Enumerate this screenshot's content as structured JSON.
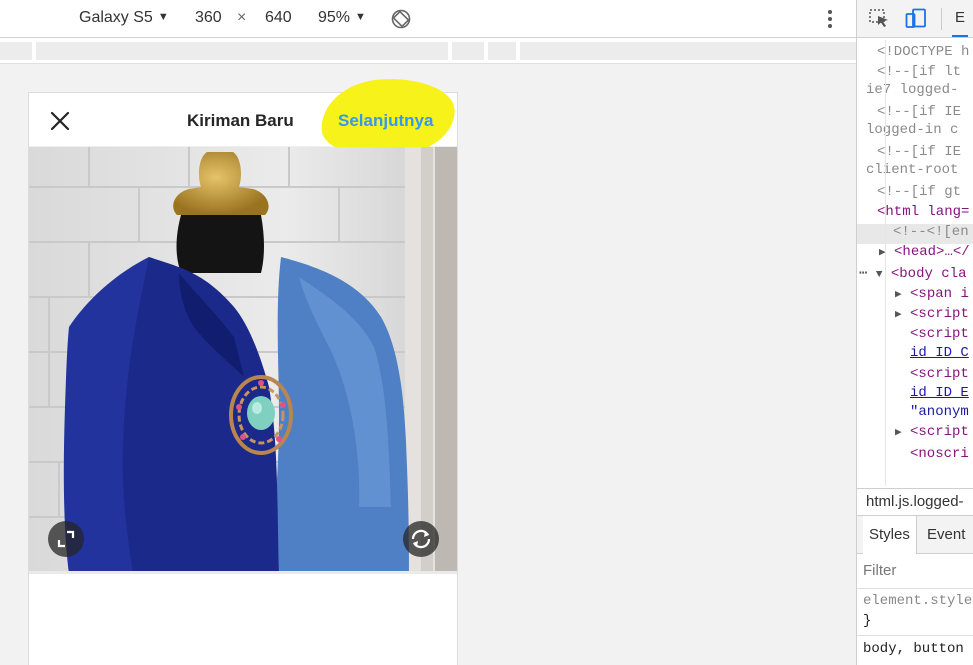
{
  "device_toolbar": {
    "device_name": "Galaxy S5",
    "width": "360",
    "times": "×",
    "height": "640",
    "zoom": "95%",
    "caret": "▼"
  },
  "app": {
    "title": "Kiriman Baru",
    "next_label": "Selanjutnya",
    "highlight_color": "#f6f21a",
    "accent_color": "#3897f0"
  },
  "devtools": {
    "active_tab": "E",
    "dom_lines": [
      {
        "text": "<!DOCTYPE h",
        "kind": "comment"
      },
      {
        "text": "<!--[if lt",
        "kind": "comment"
      },
      {
        "text": "ie7 logged-",
        "kind": "comment"
      },
      {
        "text": "<!--[if IE",
        "kind": "comment"
      },
      {
        "text": "logged-in c",
        "kind": "comment"
      },
      {
        "text": "<!--[if IE",
        "kind": "comment"
      },
      {
        "text": "client-root",
        "kind": "comment"
      },
      {
        "text": "<!--[if gt",
        "kind": "comment"
      },
      {
        "text": "<html lang=",
        "kind": "tag"
      },
      {
        "text": "<!--<![en",
        "kind": "comment"
      },
      {
        "text": "<head>…</",
        "kind": "tag"
      },
      {
        "text": "<body cla",
        "kind": "tag"
      },
      {
        "text": "<span i",
        "kind": "tag"
      },
      {
        "text": "<script",
        "kind": "tag"
      },
      {
        "text": "<script",
        "kind": "tag"
      },
      {
        "text": "id_ID_C",
        "kind": "link"
      },
      {
        "text": "<script",
        "kind": "tag"
      },
      {
        "text": "id_ID_E",
        "kind": "link"
      },
      {
        "text": "\"anonym",
        "kind": "str"
      },
      {
        "text": "<script",
        "kind": "tag"
      },
      {
        "text": "<noscri",
        "kind": "tag"
      }
    ],
    "breadcrumb": "html.js.logged-",
    "styles_tab": "Styles",
    "event_tab": "Event",
    "filter_placeholder": "Filter",
    "rule1": "element.style",
    "rule1_close": "}",
    "rule2": "body, button"
  }
}
